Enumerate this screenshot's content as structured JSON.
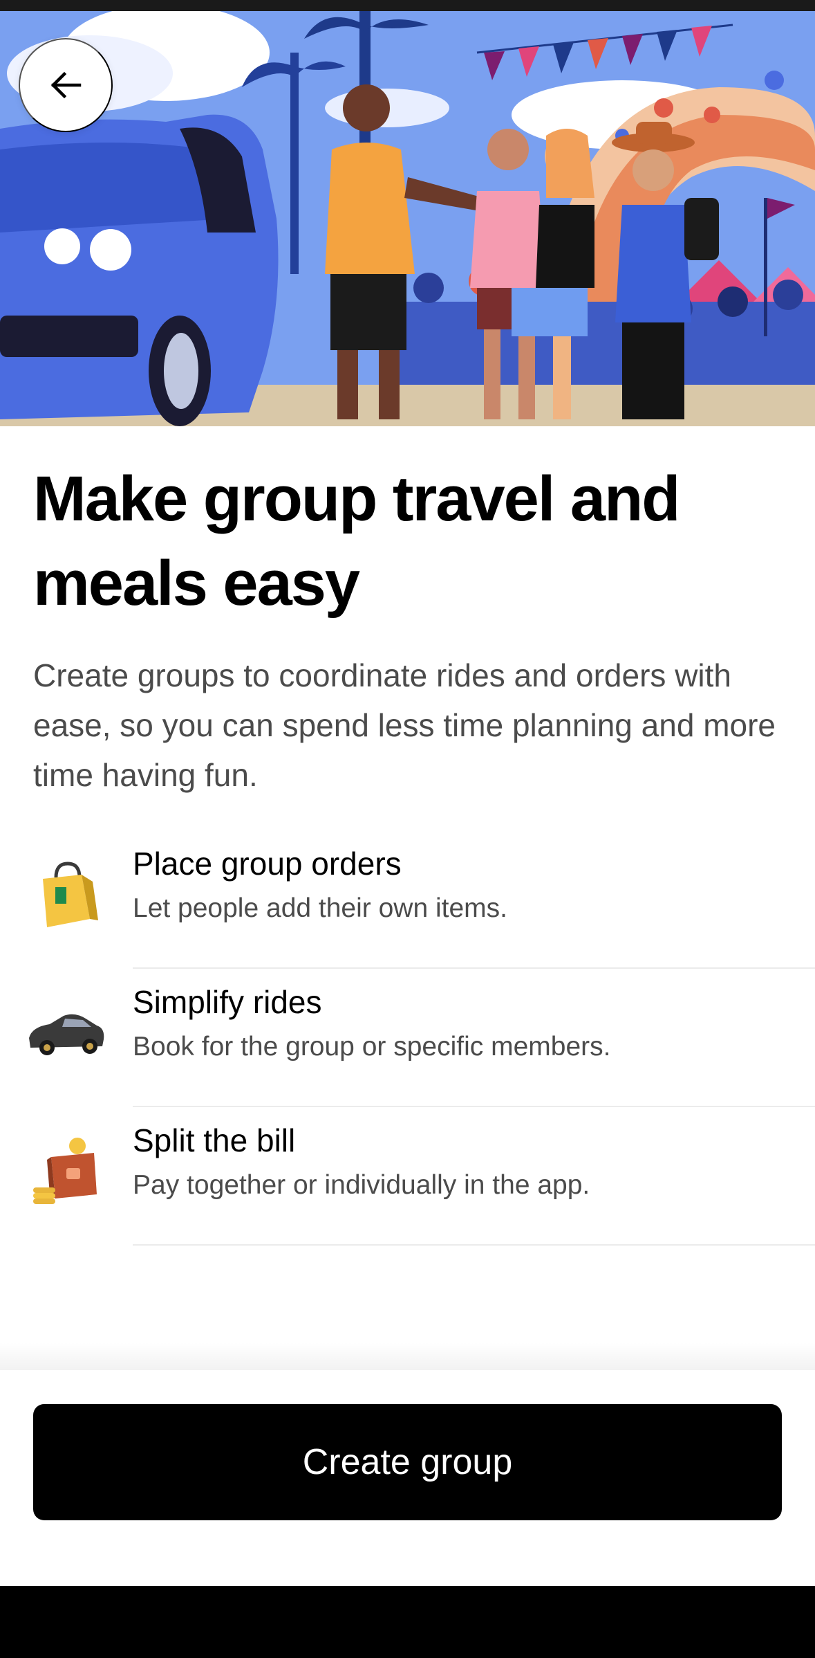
{
  "header": {
    "back_icon": "arrow-left-icon"
  },
  "hero": {
    "illustration": "group-travel-festival-illustration"
  },
  "main": {
    "title": "Make group travel and meals easy",
    "subtitle": "Create groups to coordinate rides and orders with ease, so you can spend less time planning and more time having fun."
  },
  "features": [
    {
      "icon": "shopping-bag-icon",
      "title": "Place group orders",
      "description": "Let people add their own items."
    },
    {
      "icon": "car-icon",
      "title": "Simplify rides",
      "description": "Book for the group or specific members."
    },
    {
      "icon": "wallet-coins-icon",
      "title": "Split the bill",
      "description": "Pay together or individually in the app."
    }
  ],
  "footer": {
    "cta_label": "Create group"
  },
  "colors": {
    "primary": "#000000",
    "text_secondary": "#4b4b4b",
    "divider": "#ebebeb",
    "hero_sky": "#7aa0f0"
  }
}
